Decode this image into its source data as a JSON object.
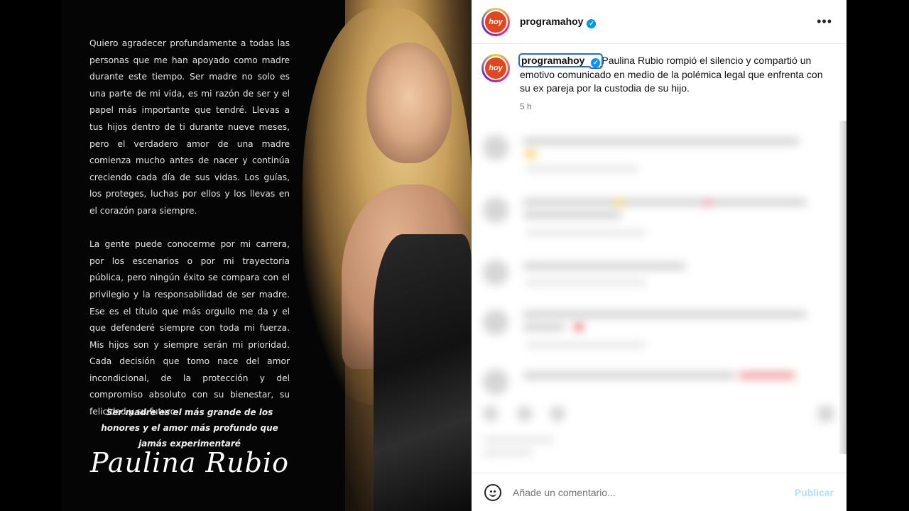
{
  "post_image": {
    "letter_paragraphs": [
      "Quiero agradecer profundamente a todas las personas que me han apoyado como madre durante este tiempo. Ser madre no solo es una parte de mi vida, es mi razón de ser y el papel más importante que tendré. Llevas a tus hijos dentro de ti durante nueve meses, pero el verdadero amor de una madre comienza mucho antes de nacer y continúa creciendo cada día de sus vidas. Los guías, los proteges, luchas por ellos y los llevas en el corazón para siempre.",
      "La gente puede conocerme por mi carrera, por los escenarios o por mi trayectoria pública, pero ningún éxito se compara con el privilegio y la responsabilidad de ser madre. Ese es el título que más orgullo me da y el que defenderé siempre con toda mi fuerza. Mis hijos son y siempre serán mi prioridad. Cada decisión que tomo nace del amor incondicional, de la protección y del compromiso absoluto con su bienestar, su felicidad y su futuro."
    ],
    "closing": "Ser madre es el más grande de los honores y el amor más profundo que jamás experimentaré",
    "signature": "Paulina Rubio"
  },
  "header": {
    "avatar_text": "hoy",
    "username": "programahoy",
    "verified_mark": "✓",
    "more_label": "•••"
  },
  "caption": {
    "avatar_text": "hoy",
    "username": "programahoy",
    "verified_mark": "✓",
    "text": "Paulina Rubio rompió el silencio y compartió un emotivo comunicado en medio de la polémica legal que enfrenta con su ex pareja por la custodia de su hijo.",
    "time": "5 h"
  },
  "comment_box": {
    "placeholder": "Añade un comentario...",
    "publish_label": "Publicar"
  },
  "colors": {
    "verified": "#0095f6",
    "publish_disabled": "#b2dffc",
    "brand_avatar": "#e2461f"
  }
}
